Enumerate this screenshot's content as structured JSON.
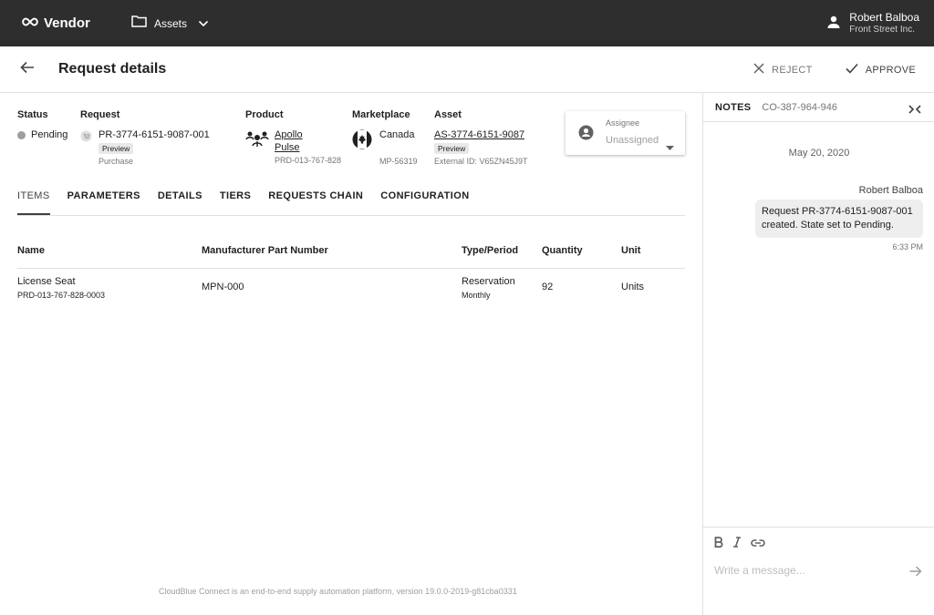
{
  "topbar": {
    "brand": "Vendor",
    "nav_label": "Assets",
    "user_name": "Robert Balboa",
    "user_company": "Front Street Inc."
  },
  "header": {
    "title": "Request details",
    "reject_label": "REJECT",
    "approve_label": "APPROVE"
  },
  "info": {
    "status": {
      "label": "Status",
      "value": "Pending"
    },
    "request": {
      "label": "Request",
      "id": "PR-3774-6151-9087-001",
      "chip": "Preview",
      "type": "Purchase"
    },
    "product": {
      "label": "Product",
      "name_line1": "Apollo",
      "name_line2": "Pulse",
      "id": "PRD-013-767-828"
    },
    "marketplace": {
      "label": "Marketplace",
      "name": "Canada",
      "id": "MP-56319"
    },
    "asset": {
      "label": "Asset",
      "id": "AS-3774-6151-9087",
      "chip": "Preview",
      "external": "External ID: V65ZN45J9T"
    },
    "assignee": {
      "label": "Assignee",
      "value": "Unassigned"
    }
  },
  "tabs": [
    {
      "label": "ITEMS",
      "active": true
    },
    {
      "label": "PARAMETERS"
    },
    {
      "label": "DETAILS"
    },
    {
      "label": "TIERS"
    },
    {
      "label": "REQUESTS CHAIN"
    },
    {
      "label": "CONFIGURATION"
    }
  ],
  "table": {
    "headers": [
      "Name",
      "Manufacturer Part Number",
      "Type/Period",
      "Quantity",
      "Unit"
    ],
    "rows": [
      {
        "name": "License Seat",
        "name_id": "PRD-013-767-828-0003",
        "mpn": "MPN-000",
        "type": "Reservation",
        "period": "Monthly",
        "quantity": "92",
        "unit": "Units"
      }
    ]
  },
  "footer": "CloudBlue Connect is an end-to-end supply automation platform, version 19.0.0-2019-g81cba0331",
  "notes": {
    "title": "NOTES",
    "id": "CO-387-964-946",
    "date": "May 20, 2020",
    "message": {
      "author": "Robert Balboa",
      "text": "Request PR-3774-6151-9087-001 created. State set to Pending.",
      "time": "6:33 PM"
    },
    "composer_placeholder": "Write a message..."
  },
  "colors": {
    "topbar_bg": "#2e2e2e",
    "divider": "#e0e0e0",
    "chip_bg": "#e8e8e8",
    "bubble_bg": "#eeeeee"
  }
}
